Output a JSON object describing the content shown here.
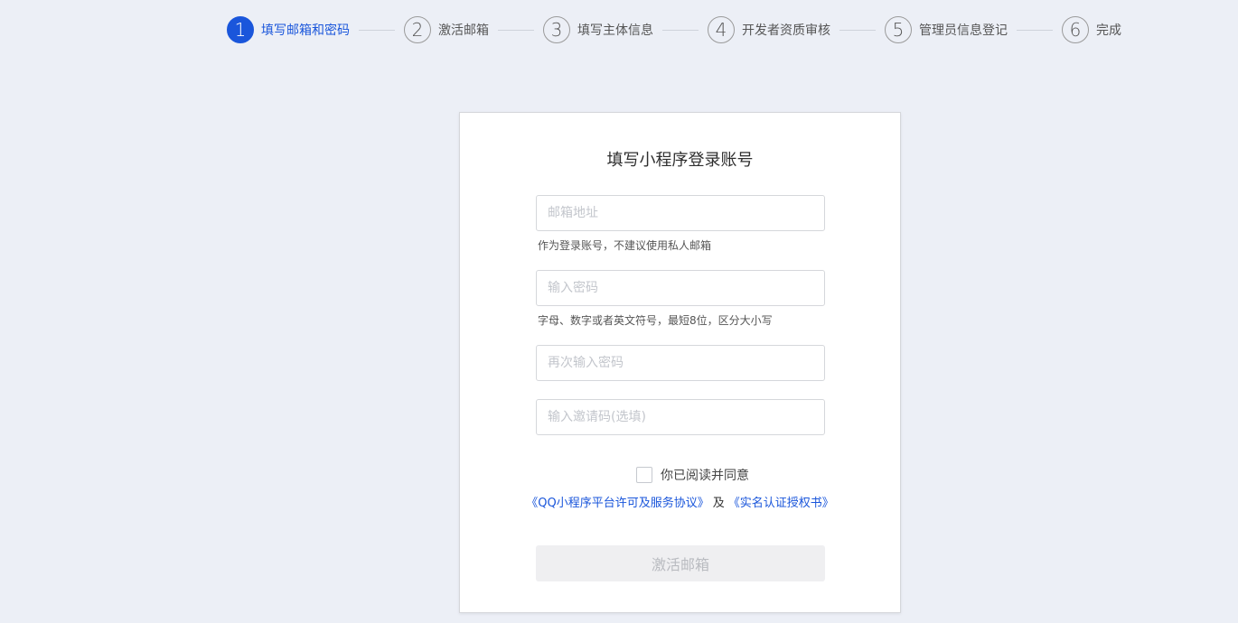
{
  "steps": [
    {
      "number": "1",
      "label": "填写邮箱和密码",
      "active": true
    },
    {
      "number": "2",
      "label": "激活邮箱",
      "active": false
    },
    {
      "number": "3",
      "label": "填写主体信息",
      "active": false
    },
    {
      "number": "4",
      "label": "开发者资质审核",
      "active": false
    },
    {
      "number": "5",
      "label": "管理员信息登记",
      "active": false
    },
    {
      "number": "6",
      "label": "完成",
      "active": false
    }
  ],
  "form": {
    "title": "填写小程序登录账号",
    "email": {
      "value": "",
      "placeholder": "邮箱地址",
      "hint": "作为登录账号，不建议使用私人邮箱"
    },
    "password": {
      "value": "",
      "placeholder": "输入密码",
      "hint": "字母、数字或者英文符号，最短8位，区分大小写"
    },
    "password_confirm": {
      "value": "",
      "placeholder": "再次输入密码"
    },
    "invite_code": {
      "value": "",
      "placeholder": "输入邀请码(选填)"
    },
    "agree": {
      "checked": false,
      "label": "你已阅读并同意"
    },
    "links": {
      "service_agreement": "《QQ小程序平台许可及服务协议》",
      "conjunction": "及",
      "auth_letter": "《实名认证授权书》"
    },
    "submit_label": "激活邮箱"
  },
  "colors": {
    "accent": "#1a56db",
    "background": "#eceff6",
    "disabled_button": "#efeff1"
  }
}
